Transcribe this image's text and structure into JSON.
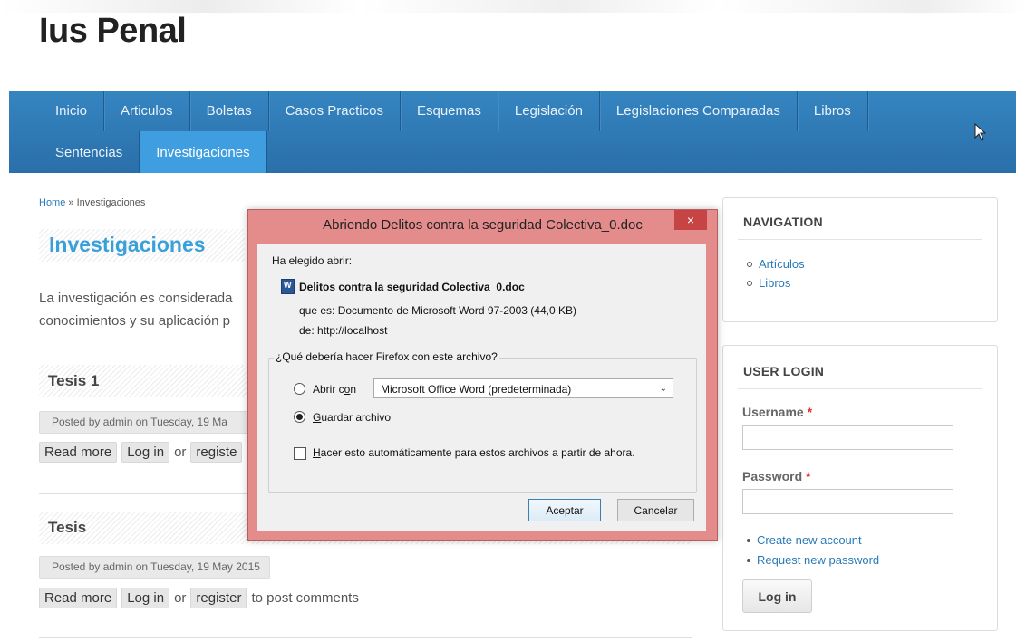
{
  "site": {
    "title": "Ius Penal"
  },
  "nav": {
    "row1": [
      "Inicio",
      "Articulos",
      "Boletas",
      "Casos Practicos",
      "Esquemas",
      "Legislación",
      "Legislaciones Comparadas",
      "Libros"
    ],
    "row2": [
      "Sentencias",
      "Investigaciones"
    ],
    "active": "Investigaciones"
  },
  "breadcrumb": {
    "home": "Home",
    "separator": "»",
    "current": "Investigaciones"
  },
  "page": {
    "title": "Investigaciones",
    "intro_line1": "La investigación es considerada",
    "intro_line2": "conocimientos y su aplicación p"
  },
  "nodes": [
    {
      "title": "Tesis 1",
      "meta": "Posted by admin on Tuesday, 19 Ma",
      "read_more": "Read more",
      "login": "Log in",
      "or": "or",
      "register": "registe",
      "suffix": ""
    },
    {
      "title": "Tesis",
      "meta": "Posted by admin on Tuesday, 19 May 2015",
      "read_more": "Read more",
      "login": "Log in",
      "or": "or",
      "register": "register",
      "suffix": "to post comments"
    }
  ],
  "sidebar": {
    "navigation": {
      "title": "NAVIGATION",
      "items": [
        "Artículos",
        "Libros"
      ]
    },
    "login": {
      "title": "USER LOGIN",
      "username_label": "Username",
      "password_label": "Password",
      "required_mark": "*",
      "links": [
        "Create new account",
        "Request new password"
      ],
      "button": "Log in"
    }
  },
  "dialog": {
    "title": "Abriendo Delitos contra la seguridad Colectiva_0.doc",
    "close": "×",
    "chosen": "Ha elegido abrir:",
    "filename": "Delitos contra la seguridad Colectiva_0.doc",
    "type_label": "que es:",
    "type_value": "Documento de Microsoft Word 97-2003 (44,0 KB)",
    "from_label": "de:",
    "from_value": "http://localhost",
    "question": "¿Qué debería hacer Firefox con este archivo?",
    "open_with_pre": "Abrir c",
    "open_with_u": "o",
    "open_with_post": "n",
    "open_with_app": "Microsoft Office Word (predeterminada)",
    "save_pre": "G",
    "save_post": "uardar archivo",
    "auto_pre": "H",
    "auto_post": "acer esto automáticamente para estos archivos a partir de ahora.",
    "accept": "Aceptar",
    "cancel": "Cancelar",
    "selected_option": "save"
  },
  "colors": {
    "nav_bg": "#2e79b5",
    "nav_active": "#3f9ee0",
    "title_blue": "#3aa0d9",
    "link": "#2a7ab8",
    "dialog_frame": "#e48b8b",
    "close_btn": "#c74444"
  }
}
